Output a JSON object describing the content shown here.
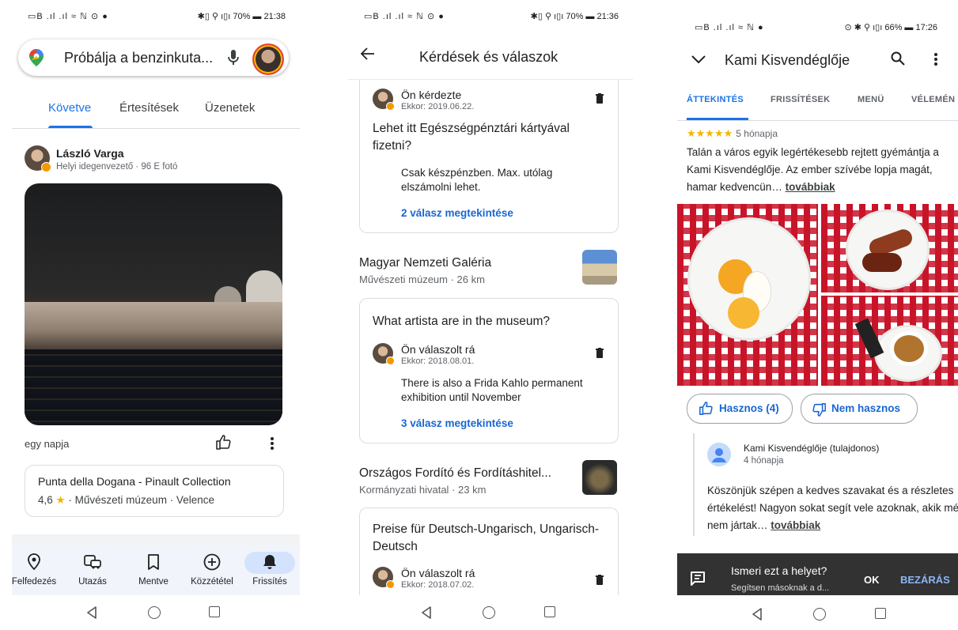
{
  "panel1": {
    "status": {
      "left": "▭B .ıl .ıl ≈ ℕ ⊙ ●",
      "right": "✱▯ ⚲ ı▯ı 70% ▬ 21:38"
    },
    "search_placeholder": "Próbálja a benzinkuta...",
    "tabs": [
      "Követve",
      "Értesítések",
      "Üzenetek"
    ],
    "post": {
      "author": "László Varga",
      "author_sub": "Helyi idegenvezető · 96 E fotó",
      "time": "egy napja",
      "place_name": "Punta della Dogana - Pinault Collection",
      "rating": "4,6",
      "place_meta": " · Művészeti múzeum · Velence"
    },
    "bottom_nav": [
      {
        "label": "Felfedezés",
        "icon": "pin-outline-icon"
      },
      {
        "label": "Utazás",
        "icon": "commute-icon"
      },
      {
        "label": "Mentve",
        "icon": "bookmark-icon"
      },
      {
        "label": "Közzététel",
        "icon": "add-circle-icon"
      },
      {
        "label": "Frissítés",
        "icon": "bell-icon"
      }
    ]
  },
  "panel2": {
    "status": {
      "left": "▭B .ıl .ıl ≈ ℕ ⊙ ●",
      "right": "✱▯ ⚲ ı▯ı 70% ▬ 21:36"
    },
    "title": "Kérdések és válaszok",
    "block1": {
      "asker": "Ön kérdezte",
      "date": "Ekkor: 2019.06.22.",
      "question": "Lehet itt Egészségpénztári kártyával fizetni?",
      "answer": "Csak készpénzben. Max. utólag elszámolni lehet.",
      "more": "2 válasz megtekintése"
    },
    "place2": {
      "name": "Magyar Nemzeti Galéria",
      "category": "Művészeti múzeum · 26 km"
    },
    "block2": {
      "question": "What artista are in the museum?",
      "answerer": "Ön válaszolt rá",
      "date": "Ekkor: 2018.08.01.",
      "answer": "There is also a Frida Kahlo permanent exhibition until November",
      "more": "3 válasz megtekintése"
    },
    "place3": {
      "name": "Országos Fordító és Fordításhitel...",
      "category": "Kormányzati hivatal · 23 km"
    },
    "block3": {
      "question": "Preise für Deutsch-Ungarisch, Ungarisch-Deutsch",
      "answerer": "Ön válaszolt rá",
      "date": "Ekkor: 2018.07.02."
    }
  },
  "panel3": {
    "status": {
      "left": "▭B .ıl .ıl ≈ ℕ ●",
      "right": "⊙ ✱ ⚲ ı▯ı 66% ▬ 17:26"
    },
    "title": "Kami Kisvendéglője",
    "tabs": [
      "ÁTTEKINTÉS",
      "FRISSÍTÉSEK",
      "MENÜ",
      "VÉLEMÉN"
    ],
    "review": {
      "stars": "★★★★★",
      "ago": "5 hónapja",
      "text": "Talán a város egyik legértékesebb rejtett gyémántja a Kami Kisvendéglője. Az ember szívébe lopja magát, hamar kedvencün… ",
      "more": "továbbiak"
    },
    "useful": "Hasznos (4)",
    "not_useful": "Nem hasznos",
    "owner": {
      "name": "Kami Kisvendéglője (tulajdonos)",
      "ago": "4 hónapja",
      "text": "Köszönjük szépen a kedves szavakat és a részletes értékelést! Nagyon sokat segít vele azoknak, akik még nem jártak… ",
      "more": "továbbiak"
    },
    "snackbar": {
      "title": "Ismeri ezt a helyet?",
      "subtitle": "Segítsen másoknak a d...",
      "ok": "OK",
      "close": "BEZÁRÁS"
    }
  },
  "colors": {
    "accent": "#1a73e8",
    "star": "#f4b400",
    "snackbar": "#323232"
  }
}
